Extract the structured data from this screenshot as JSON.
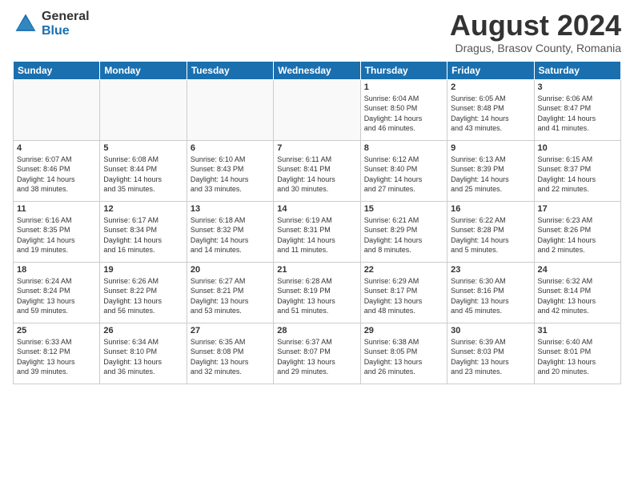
{
  "header": {
    "logo_general": "General",
    "logo_blue": "Blue",
    "month_year": "August 2024",
    "location": "Dragus, Brasov County, Romania"
  },
  "weekdays": [
    "Sunday",
    "Monday",
    "Tuesday",
    "Wednesday",
    "Thursday",
    "Friday",
    "Saturday"
  ],
  "weeks": [
    [
      {
        "day": "",
        "info": ""
      },
      {
        "day": "",
        "info": ""
      },
      {
        "day": "",
        "info": ""
      },
      {
        "day": "",
        "info": ""
      },
      {
        "day": "1",
        "info": "Sunrise: 6:04 AM\nSunset: 8:50 PM\nDaylight: 14 hours\nand 46 minutes."
      },
      {
        "day": "2",
        "info": "Sunrise: 6:05 AM\nSunset: 8:48 PM\nDaylight: 14 hours\nand 43 minutes."
      },
      {
        "day": "3",
        "info": "Sunrise: 6:06 AM\nSunset: 8:47 PM\nDaylight: 14 hours\nand 41 minutes."
      }
    ],
    [
      {
        "day": "4",
        "info": "Sunrise: 6:07 AM\nSunset: 8:46 PM\nDaylight: 14 hours\nand 38 minutes."
      },
      {
        "day": "5",
        "info": "Sunrise: 6:08 AM\nSunset: 8:44 PM\nDaylight: 14 hours\nand 35 minutes."
      },
      {
        "day": "6",
        "info": "Sunrise: 6:10 AM\nSunset: 8:43 PM\nDaylight: 14 hours\nand 33 minutes."
      },
      {
        "day": "7",
        "info": "Sunrise: 6:11 AM\nSunset: 8:41 PM\nDaylight: 14 hours\nand 30 minutes."
      },
      {
        "day": "8",
        "info": "Sunrise: 6:12 AM\nSunset: 8:40 PM\nDaylight: 14 hours\nand 27 minutes."
      },
      {
        "day": "9",
        "info": "Sunrise: 6:13 AM\nSunset: 8:39 PM\nDaylight: 14 hours\nand 25 minutes."
      },
      {
        "day": "10",
        "info": "Sunrise: 6:15 AM\nSunset: 8:37 PM\nDaylight: 14 hours\nand 22 minutes."
      }
    ],
    [
      {
        "day": "11",
        "info": "Sunrise: 6:16 AM\nSunset: 8:35 PM\nDaylight: 14 hours\nand 19 minutes."
      },
      {
        "day": "12",
        "info": "Sunrise: 6:17 AM\nSunset: 8:34 PM\nDaylight: 14 hours\nand 16 minutes."
      },
      {
        "day": "13",
        "info": "Sunrise: 6:18 AM\nSunset: 8:32 PM\nDaylight: 14 hours\nand 14 minutes."
      },
      {
        "day": "14",
        "info": "Sunrise: 6:19 AM\nSunset: 8:31 PM\nDaylight: 14 hours\nand 11 minutes."
      },
      {
        "day": "15",
        "info": "Sunrise: 6:21 AM\nSunset: 8:29 PM\nDaylight: 14 hours\nand 8 minutes."
      },
      {
        "day": "16",
        "info": "Sunrise: 6:22 AM\nSunset: 8:28 PM\nDaylight: 14 hours\nand 5 minutes."
      },
      {
        "day": "17",
        "info": "Sunrise: 6:23 AM\nSunset: 8:26 PM\nDaylight: 14 hours\nand 2 minutes."
      }
    ],
    [
      {
        "day": "18",
        "info": "Sunrise: 6:24 AM\nSunset: 8:24 PM\nDaylight: 13 hours\nand 59 minutes."
      },
      {
        "day": "19",
        "info": "Sunrise: 6:26 AM\nSunset: 8:22 PM\nDaylight: 13 hours\nand 56 minutes."
      },
      {
        "day": "20",
        "info": "Sunrise: 6:27 AM\nSunset: 8:21 PM\nDaylight: 13 hours\nand 53 minutes."
      },
      {
        "day": "21",
        "info": "Sunrise: 6:28 AM\nSunset: 8:19 PM\nDaylight: 13 hours\nand 51 minutes."
      },
      {
        "day": "22",
        "info": "Sunrise: 6:29 AM\nSunset: 8:17 PM\nDaylight: 13 hours\nand 48 minutes."
      },
      {
        "day": "23",
        "info": "Sunrise: 6:30 AM\nSunset: 8:16 PM\nDaylight: 13 hours\nand 45 minutes."
      },
      {
        "day": "24",
        "info": "Sunrise: 6:32 AM\nSunset: 8:14 PM\nDaylight: 13 hours\nand 42 minutes."
      }
    ],
    [
      {
        "day": "25",
        "info": "Sunrise: 6:33 AM\nSunset: 8:12 PM\nDaylight: 13 hours\nand 39 minutes."
      },
      {
        "day": "26",
        "info": "Sunrise: 6:34 AM\nSunset: 8:10 PM\nDaylight: 13 hours\nand 36 minutes."
      },
      {
        "day": "27",
        "info": "Sunrise: 6:35 AM\nSunset: 8:08 PM\nDaylight: 13 hours\nand 32 minutes."
      },
      {
        "day": "28",
        "info": "Sunrise: 6:37 AM\nSunset: 8:07 PM\nDaylight: 13 hours\nand 29 minutes."
      },
      {
        "day": "29",
        "info": "Sunrise: 6:38 AM\nSunset: 8:05 PM\nDaylight: 13 hours\nand 26 minutes."
      },
      {
        "day": "30",
        "info": "Sunrise: 6:39 AM\nSunset: 8:03 PM\nDaylight: 13 hours\nand 23 minutes."
      },
      {
        "day": "31",
        "info": "Sunrise: 6:40 AM\nSunset: 8:01 PM\nDaylight: 13 hours\nand 20 minutes."
      }
    ]
  ]
}
